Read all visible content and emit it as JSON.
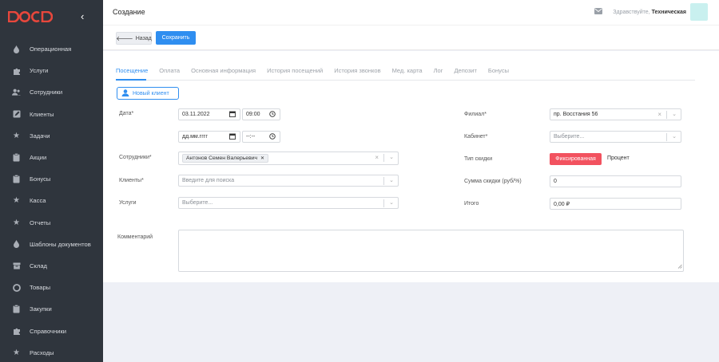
{
  "sidebar": {
    "logo_text": "DOCD",
    "items": [
      {
        "label": "Операционная",
        "icon": "drop-icon"
      },
      {
        "label": "Услуги",
        "icon": "puzzle-icon"
      },
      {
        "label": "Сотрудники",
        "icon": "users-icon"
      },
      {
        "label": "Клиенты",
        "icon": "edit-icon"
      },
      {
        "label": "Задачи",
        "icon": "star-icon"
      },
      {
        "label": "Акции",
        "icon": "clipboard-icon"
      },
      {
        "label": "Бонусы",
        "icon": "clipboard-icon"
      },
      {
        "label": "Касса",
        "icon": "star-icon"
      },
      {
        "label": "Отчеты",
        "icon": "star-icon"
      },
      {
        "label": "Шаблоны документов",
        "icon": "drop-icon"
      },
      {
        "label": "Склад",
        "icon": "box-icon"
      },
      {
        "label": "Товары",
        "icon": "circle-icon"
      },
      {
        "label": "Закупки",
        "icon": "clipboard-icon"
      },
      {
        "label": "Справочники",
        "icon": "puzzle-icon"
      },
      {
        "label": "Расходы",
        "icon": "star-icon"
      }
    ]
  },
  "header": {
    "title": "Создание",
    "greeting": "Здравствуйте,",
    "user_name": "Техническая"
  },
  "toolbar": {
    "back_label": "Назад",
    "save_label": "Сохранить"
  },
  "tabs": [
    "Посещение",
    "Оплата",
    "Основная информация",
    "История посещений",
    "История звонков",
    "Мед. карта",
    "Лог",
    "Депозит",
    "Бонусы"
  ],
  "active_tab": "Посещение",
  "new_client_label": "Новый клиент",
  "form": {
    "date_label": "Дата*",
    "date_value": "03.11.2022",
    "time_value": "09:00",
    "date2_placeholder": "дд.мм.гггг",
    "time2_placeholder": "--:--",
    "employees_label": "Сотрудники*",
    "employee_tag": "Антонов Семен Валерьевич",
    "clients_label": "Клиенты*",
    "clients_placeholder": "Введите для поиска",
    "services_label": "Услуги",
    "services_placeholder": "Выберите...",
    "branch_label": "Филиал*",
    "branch_value": "пр. Восстания 56",
    "cabinet_label": "Кабинет*",
    "cabinet_placeholder": "Выберите...",
    "discount_type_label": "Тип скидки",
    "discount_fixed": "Фиксированная",
    "discount_percent": "Процент",
    "discount_sum_label": "Сумма скидки (руб/%)",
    "discount_sum_value": "0",
    "total_label": "Итого",
    "total_value": "0,00 ₽",
    "comment_label": "Комментарий"
  },
  "colors": {
    "sidebar_bg": "#2f353d",
    "accent": "#2f8ef0",
    "danger": "#f2525f",
    "logo": "#e8473c"
  }
}
